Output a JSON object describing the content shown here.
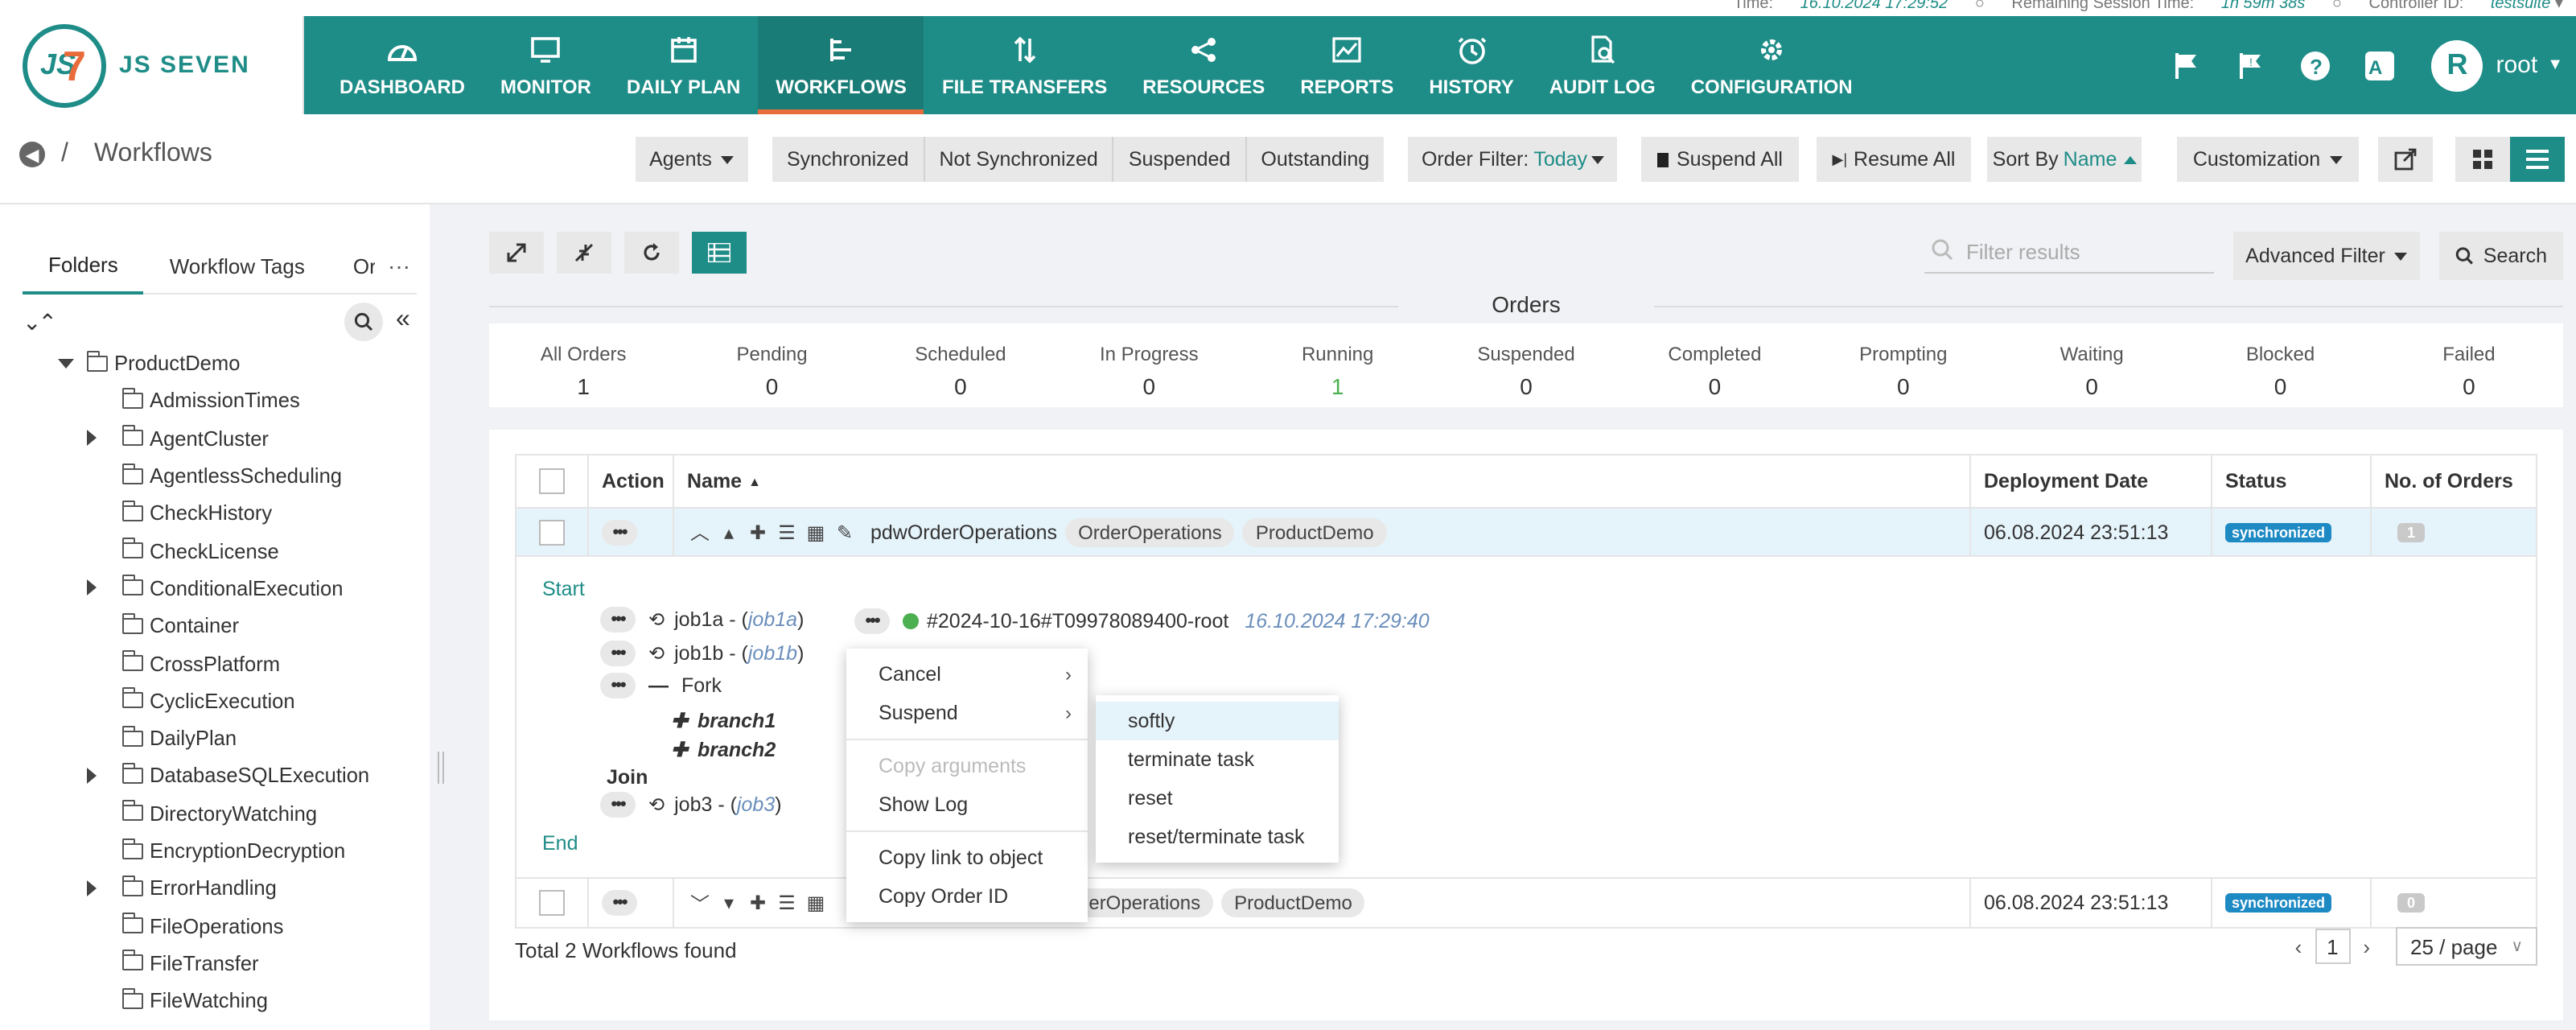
{
  "status_strip": {
    "time_label": "Time:",
    "time_value": "16.10.2024 17:29:52",
    "session_label": "Remaining Session Time:",
    "session_value": "1h 59m 38s",
    "controller_label": "Controller ID:",
    "controller_value": "testsuite"
  },
  "header": {
    "logo_text": "JS SEVEN",
    "nav": [
      {
        "label": "DASHBOARD",
        "icon": "dashboard-icon"
      },
      {
        "label": "MONITOR",
        "icon": "monitor-icon"
      },
      {
        "label": "DAILY PLAN",
        "icon": "calendar-icon"
      },
      {
        "label": "WORKFLOWS",
        "icon": "workflow-icon",
        "active": true
      },
      {
        "label": "FILE TRANSFERS",
        "icon": "transfer-icon"
      },
      {
        "label": "RESOURCES",
        "icon": "share-icon"
      },
      {
        "label": "REPORTS",
        "icon": "chart-icon"
      },
      {
        "label": "HISTORY",
        "icon": "clock-icon"
      },
      {
        "label": "AUDIT LOG",
        "icon": "audit-icon"
      },
      {
        "label": "CONFIGURATION",
        "icon": "gear-icon"
      }
    ],
    "avatar_initial": "R",
    "username": "root"
  },
  "breadcrumb": {
    "sep": "/",
    "title": "Workflows"
  },
  "toolbar": {
    "agents": "Agents",
    "state_filters": [
      "Synchronized",
      "Not Synchronized",
      "Suspended",
      "Outstanding"
    ],
    "order_filter_label": "Order Filter:",
    "order_filter_value": "Today",
    "suspend_all": "Suspend All",
    "resume_all": "Resume All",
    "sort_by_label": "Sort By",
    "sort_by_value": "Name",
    "customization": "Customization"
  },
  "sidebar": {
    "tabs": [
      "Folders",
      "Workflow Tags",
      "Ord"
    ],
    "more": "···",
    "root_folder": "ProductDemo",
    "folders": [
      {
        "name": "AdmissionTimes",
        "expandable": false
      },
      {
        "name": "AgentCluster",
        "expandable": true
      },
      {
        "name": "AgentlessScheduling",
        "expandable": false
      },
      {
        "name": "CheckHistory",
        "expandable": false
      },
      {
        "name": "CheckLicense",
        "expandable": false
      },
      {
        "name": "ConditionalExecution",
        "expandable": true
      },
      {
        "name": "Container",
        "expandable": false
      },
      {
        "name": "CrossPlatform",
        "expandable": false
      },
      {
        "name": "CyclicExecution",
        "expandable": false
      },
      {
        "name": "DailyPlan",
        "expandable": false
      },
      {
        "name": "DatabaseSQLExecution",
        "expandable": true
      },
      {
        "name": "DirectoryWatching",
        "expandable": false
      },
      {
        "name": "EncryptionDecryption",
        "expandable": false
      },
      {
        "name": "ErrorHandling",
        "expandable": true
      },
      {
        "name": "FileOperations",
        "expandable": false
      },
      {
        "name": "FileTransfer",
        "expandable": false
      },
      {
        "name": "FileWatching",
        "expandable": false
      }
    ]
  },
  "main": {
    "filter_placeholder": "Filter results",
    "advanced_filter": "Advanced Filter",
    "search": "Search",
    "orders_title": "Orders",
    "order_stats": [
      {
        "label": "All Orders",
        "value": "1"
      },
      {
        "label": "Pending",
        "value": "0"
      },
      {
        "label": "Scheduled",
        "value": "0"
      },
      {
        "label": "In Progress",
        "value": "0"
      },
      {
        "label": "Running",
        "value": "1",
        "highlight": true
      },
      {
        "label": "Suspended",
        "value": "0"
      },
      {
        "label": "Completed",
        "value": "0"
      },
      {
        "label": "Prompting",
        "value": "0"
      },
      {
        "label": "Waiting",
        "value": "0"
      },
      {
        "label": "Blocked",
        "value": "0"
      },
      {
        "label": "Failed",
        "value": "0"
      }
    ],
    "table": {
      "columns": [
        "Action",
        "Name",
        "Deployment Date",
        "Status",
        "No. of Orders"
      ],
      "rows": [
        {
          "name": "pdwOrderOperations",
          "tags": [
            "OrderOperations",
            "ProductDemo"
          ],
          "deployed": "06.08.2024 23:51:13",
          "status": "synchronized",
          "orders": "1"
        },
        {
          "name": "",
          "tags": [
            "OrderOperations",
            "ProductDemo"
          ],
          "tags_visible": [
            "rderOperations",
            "ProductDemo"
          ],
          "deployed": "06.08.2024 23:51:13",
          "status": "synchronized",
          "orders": "0"
        }
      ],
      "detail": {
        "start": "Start",
        "end": "End",
        "join": "Join",
        "fork": "Fork",
        "jobs": [
          {
            "name": "job1a -",
            "ref": "job1a"
          },
          {
            "name": "job1b -",
            "ref": "job1b"
          },
          {
            "name": "job3 -",
            "ref": "job3"
          }
        ],
        "branches": [
          "branch1",
          "branch2"
        ],
        "order_id": "#2024-10-16#T09978089400-root",
        "order_time": "16.10.2024 17:29:40"
      }
    },
    "footer": "Total 2 Workflows found",
    "page": "1",
    "page_size": "25 / page"
  },
  "context_menu": {
    "items": [
      "Cancel",
      "Suspend",
      "Copy arguments",
      "Show Log",
      "Copy link to object",
      "Copy Order ID"
    ],
    "submenu": [
      "softly",
      "terminate task",
      "reset",
      "reset/terminate task"
    ]
  },
  "colors": {
    "brand": "#1e8c87",
    "accent": "#e96b3c",
    "sync_badge": "#1e8ac4"
  }
}
